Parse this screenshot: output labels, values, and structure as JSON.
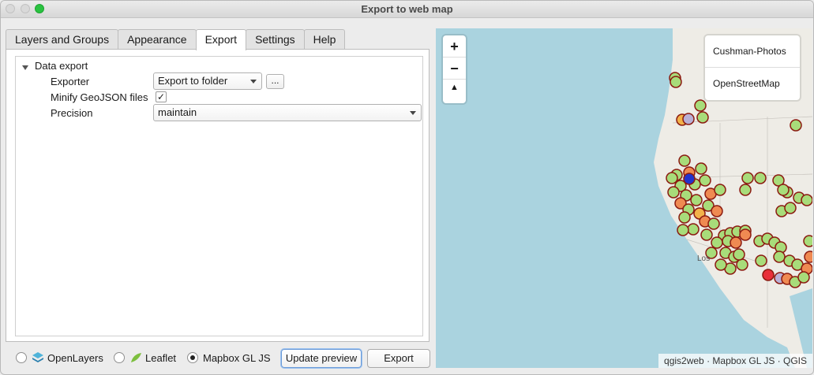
{
  "window": {
    "title": "Export to web map"
  },
  "tabs": [
    "Layers and Groups",
    "Appearance",
    "Export",
    "Settings",
    "Help"
  ],
  "active_tab": "Export",
  "export_panel": {
    "section_label": "Data export",
    "exporter_label": "Exporter",
    "exporter_value": "Export to folder",
    "browse_label": "...",
    "minify_label": "Minify GeoJSON files",
    "minify_checked": "✓",
    "precision_label": "Precision",
    "precision_value": "maintain"
  },
  "bottom": {
    "radio_openlayers": "OpenLayers",
    "radio_leaflet": "Leaflet",
    "radio_mapbox": "Mapbox GL JS",
    "selected": "Mapbox GL JS",
    "update_preview": "Update preview",
    "export": "Export"
  },
  "map": {
    "zoom_in": "+",
    "zoom_out": "−",
    "compass": "▲",
    "layers": [
      "Cushman-Photos",
      "OpenStreetMap"
    ],
    "city_label": "Los",
    "attribution": "qgis2web · Mapbox GL JS · QGIS",
    "colors": {
      "water": "#aad3df",
      "land": "#eeece6",
      "marker_green": "#a8dc7a",
      "marker_orange": "#ef8a52",
      "marker_yellow": "#f2b24a",
      "marker_red": "#e8303a",
      "marker_blue": "#2233cc",
      "marker_stroke": "#8b1a10"
    }
  }
}
